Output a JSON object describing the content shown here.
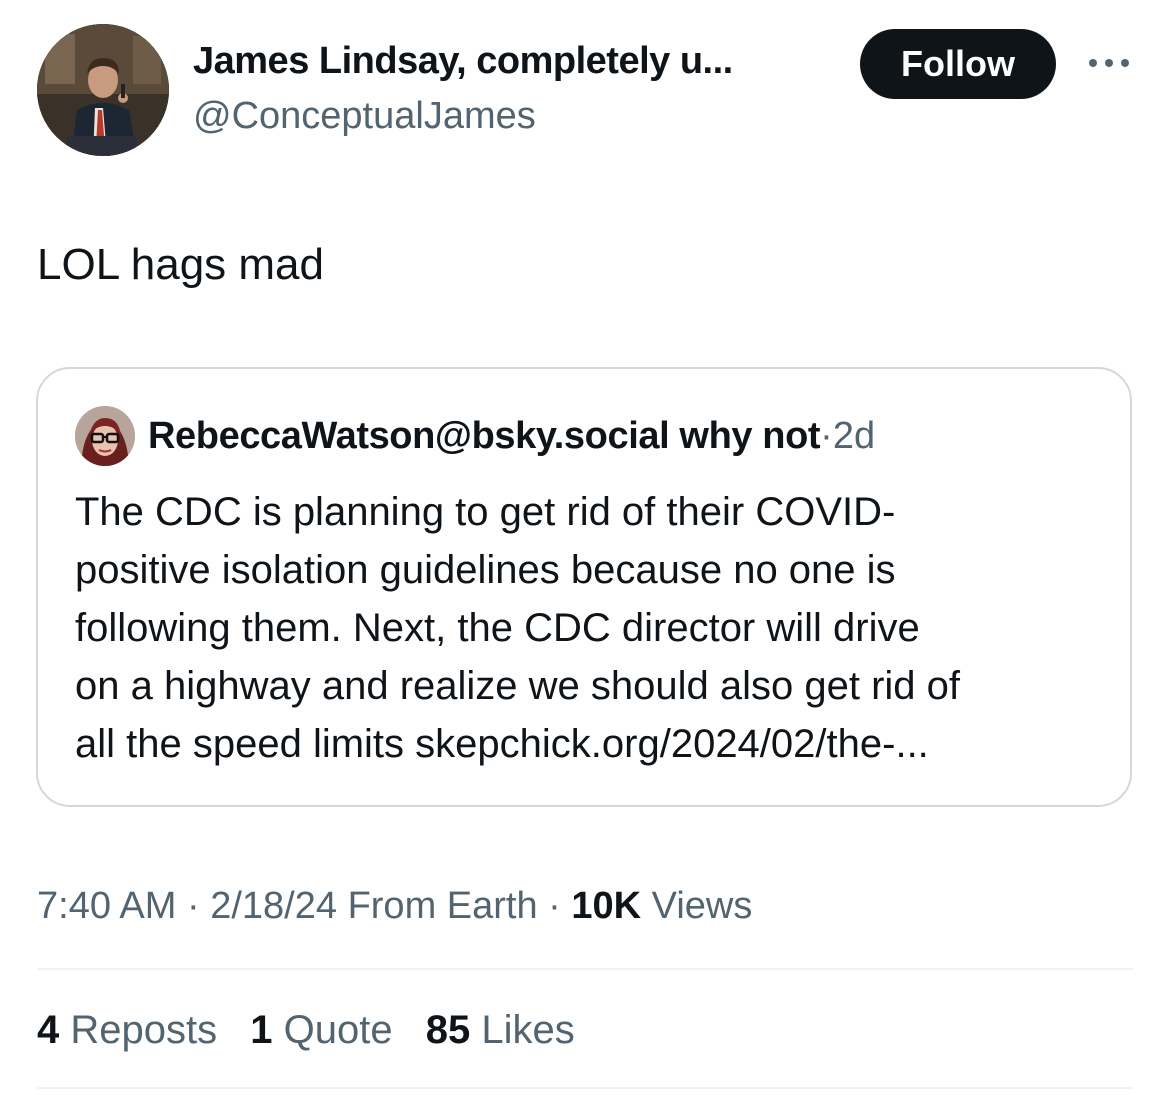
{
  "author": {
    "display_name": "James Lindsay, completely u...",
    "handle": "@ConceptualJames",
    "avatar_icon": "profile-photo-man-with-microphone"
  },
  "follow_button": {
    "label": "Follow"
  },
  "more_menu": {
    "icon": "more-horizontal-icon"
  },
  "tweet": {
    "text": "LOL hags mad"
  },
  "quoted_tweet": {
    "name": "RebeccaWatson@bsky.social why not",
    "separator": "·",
    "time": "2d",
    "avatar_icon": "profile-photo-woman-with-glasses",
    "body_lines": [
      "The CDC is planning to get rid of their COVID-",
      "positive isolation guidelines because no one is",
      "following them. Next, the CDC director will drive",
      "on a highway and realize we should also get rid of",
      "all the speed limits skepchick.org/2024/02/the-..."
    ]
  },
  "meta": {
    "time": "7:40 AM",
    "sep1": "·",
    "date": "2/18/24",
    "source": "From Earth",
    "sep2": "·",
    "views_count": "10K",
    "views_label": "Views"
  },
  "stats": {
    "reposts_count": "4",
    "reposts_label": "Reposts",
    "quotes_count": "1",
    "quotes_label": "Quote",
    "likes_count": "85",
    "likes_label": "Likes"
  },
  "colors": {
    "text_primary": "#0f1419",
    "text_secondary": "#536471",
    "border": "#cfd9de",
    "divider": "#eff3f4",
    "button_bg": "#0f1419",
    "button_text": "#ffffff"
  }
}
